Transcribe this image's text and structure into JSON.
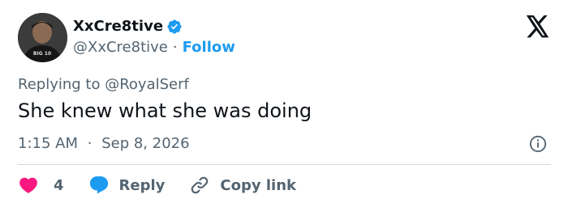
{
  "author": {
    "display_name": "XxCre8tive",
    "handle": "@XxCre8tive",
    "separator": "·",
    "follow_label": "Follow",
    "verified": true,
    "avatar_text": "BIG 10"
  },
  "reply": {
    "prefix": "Replying to",
    "mention": "@RoyalSerf"
  },
  "tweet": {
    "text": "She knew what she was doing",
    "time": "1:15 AM",
    "separator": "·",
    "date": "Sep 8, 2026"
  },
  "actions": {
    "like_count": "4",
    "reply_label": "Reply",
    "copy_label": "Copy link"
  },
  "icons": {
    "verified": "verified-badge-icon",
    "logo": "x-logo-icon",
    "info": "info-icon",
    "like": "heart-icon",
    "reply": "speech-bubble-icon",
    "copy": "link-icon"
  },
  "colors": {
    "accent": "#1d9bf0",
    "like": "#f91880",
    "text": "#0f1419",
    "muted": "#536471",
    "divider": "#cfd9de"
  }
}
